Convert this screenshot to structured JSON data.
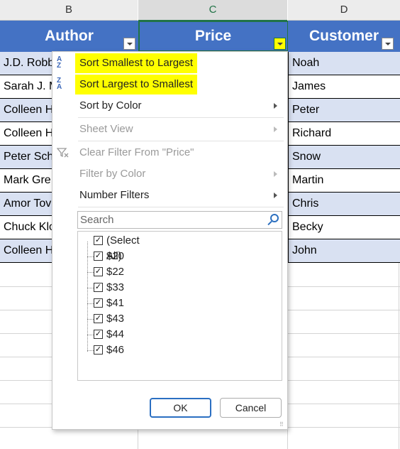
{
  "columns": [
    {
      "letter": "B",
      "header": "Author"
    },
    {
      "letter": "C",
      "header": "Price"
    },
    {
      "letter": "D",
      "header": "Customer"
    }
  ],
  "rows": [
    {
      "author": "J.D. Robb",
      "customer": "Noah"
    },
    {
      "author": "Sarah J. M",
      "customer": "James"
    },
    {
      "author": "Colleen H",
      "customer": "Peter"
    },
    {
      "author": "Colleen H",
      "customer": "Richard"
    },
    {
      "author": "Peter Sch",
      "customer": "Snow"
    },
    {
      "author": "Mark Gre",
      "customer": "Martin"
    },
    {
      "author": "Amor Tov",
      "customer": "Chris"
    },
    {
      "author": "Chuck Klo",
      "customer": "Becky"
    },
    {
      "author": "Colleen H",
      "customer": "John"
    }
  ],
  "menu": {
    "sort_asc": "Sort Smallest to Largest",
    "sort_desc": "Sort Largest to Smallest",
    "sort_by_color": "Sort by Color",
    "sheet_view": "Sheet View",
    "clear_filter": "Clear Filter From \"Price\"",
    "filter_by_color": "Filter by Color",
    "number_filters": "Number Filters",
    "search_placeholder": "Search",
    "values": [
      "(Select All)",
      "$20",
      "$22",
      "$33",
      "$41",
      "$43",
      "$44",
      "$46"
    ],
    "ok": "OK",
    "cancel": "Cancel",
    "sort_asc_icon_top": "A",
    "sort_asc_icon_bottom": "Z",
    "sort_desc_icon_top": "Z",
    "sort_desc_icon_bottom": "A"
  },
  "colors": {
    "header_fill": "#4472c4",
    "band_fill": "#d9e1f2",
    "highlight": "#ffff00",
    "selected_border": "#217346"
  }
}
